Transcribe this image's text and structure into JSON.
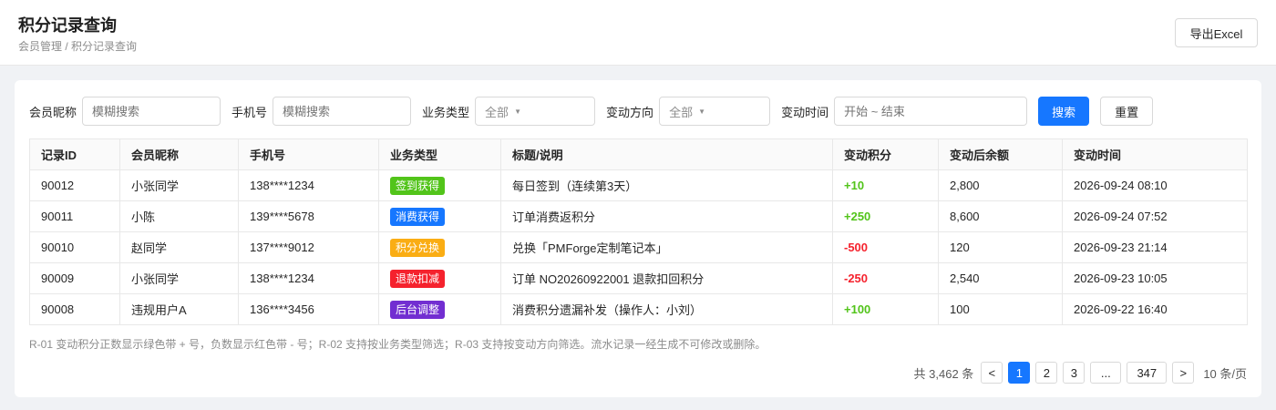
{
  "header": {
    "title": "积分记录查询",
    "breadcrumb": "会员管理 / 积分记录查询",
    "export_label": "导出Excel"
  },
  "filters": {
    "nickname_label": "会员昵称",
    "nickname_placeholder": "模糊搜索",
    "phone_label": "手机号",
    "phone_placeholder": "模糊搜索",
    "biz_type_label": "业务类型",
    "biz_type_value": "全部",
    "direction_label": "变动方向",
    "direction_value": "全部",
    "time_label": "变动时间",
    "time_placeholder": "开始 ~ 结束",
    "search_label": "搜索",
    "reset_label": "重置"
  },
  "table": {
    "columns": [
      "记录ID",
      "会员昵称",
      "手机号",
      "业务类型",
      "标题/说明",
      "变动积分",
      "变动后余额",
      "变动时间"
    ],
    "rows": [
      {
        "id": "90012",
        "nickname": "小张同学",
        "phone": "138****1234",
        "type": "签到获得",
        "type_color": "#52c41a",
        "desc": "每日签到（连续第3天）",
        "points": "+10",
        "balance": "2,800",
        "time": "2026-09-24 08:10"
      },
      {
        "id": "90011",
        "nickname": "小陈",
        "phone": "139****5678",
        "type": "消费获得",
        "type_color": "#1677ff",
        "desc": "订单消费返积分",
        "points": "+250",
        "balance": "8,600",
        "time": "2026-09-24 07:52"
      },
      {
        "id": "90010",
        "nickname": "赵同学",
        "phone": "137****9012",
        "type": "积分兑换",
        "type_color": "#faad14",
        "desc": "兑换「PMForge定制笔记本」",
        "points": "-500",
        "balance": "120",
        "time": "2026-09-23 21:14"
      },
      {
        "id": "90009",
        "nickname": "小张同学",
        "phone": "138****1234",
        "type": "退款扣减",
        "type_color": "#f5222d",
        "desc": "订单 NO20260922001 退款扣回积分",
        "points": "-250",
        "balance": "2,540",
        "time": "2026-09-23 10:05"
      },
      {
        "id": "90008",
        "nickname": "违规用户A",
        "phone": "136****3456",
        "type": "后台调整",
        "type_color": "#722ed1",
        "desc": "消费积分遗漏补发（操作人：小刘）",
        "points": "+100",
        "balance": "100",
        "time": "2026-09-22 16:40"
      }
    ]
  },
  "note": "R-01 变动积分正数显示绿色带 + 号，负数显示红色带 - 号；R-02 支持按业务类型筛选；R-03 支持按变动方向筛选。流水记录一经生成不可修改或删除。",
  "pagination": {
    "total_text": "共 3,462 条",
    "prev": "<",
    "pages": [
      "1",
      "2",
      "3",
      "...",
      "347"
    ],
    "current": "1",
    "next": ">",
    "page_size_text": "10 条/页"
  },
  "colors": {
    "primary": "#1677ff",
    "positive": "#52c41a",
    "negative": "#f5222d"
  }
}
